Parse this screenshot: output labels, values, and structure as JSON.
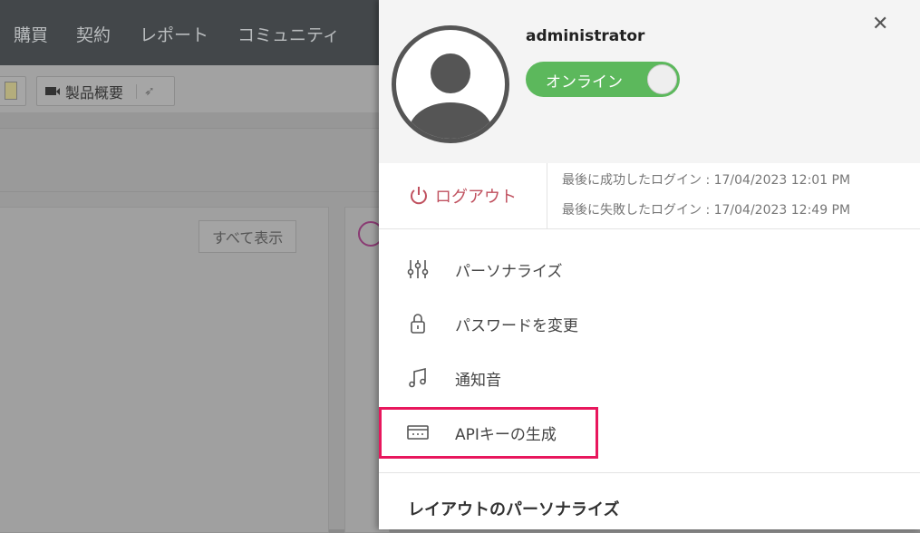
{
  "background": {
    "nav": [
      "購買",
      "契約",
      "レポート",
      "コミュニティ"
    ],
    "toolbar": {
      "product_overview": "製品概要"
    },
    "show_all": "すべて表示"
  },
  "panel": {
    "username": "administrator",
    "status_toggle": "オンライン",
    "logout": "ログアウト",
    "last_success_login": "最後に成功したログイン : 17/04/2023 12:01 PM",
    "last_failed_login": "最後に失敗したログイン : 17/04/2023 12:49 PM",
    "menu": [
      {
        "label": "パーソナライズ",
        "icon": "sliders-icon"
      },
      {
        "label": "パスワードを変更",
        "icon": "lock-icon"
      },
      {
        "label": "通知音",
        "icon": "music-note-icon"
      },
      {
        "label": "APIキーの生成",
        "icon": "api-key-icon"
      }
    ],
    "section_heading": "レイアウトのパーソナライズ"
  },
  "colors": {
    "highlight": "#e8175d",
    "toggle": "#5cb85c",
    "logout": "#c0515f"
  }
}
